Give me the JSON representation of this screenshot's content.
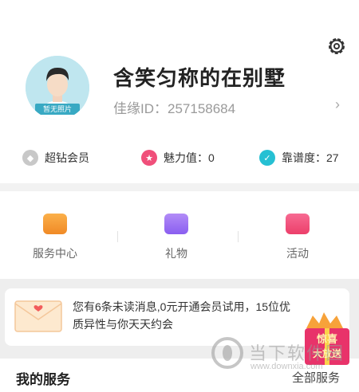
{
  "profile": {
    "avatar_tag": "暂无照片",
    "nickname": "含笑匀称的在别墅",
    "uid": "佳缘ID：257158684"
  },
  "stats": [
    {
      "icon": "diamond-icon",
      "label": "超钻会员"
    },
    {
      "icon": "star-icon",
      "label": "魅力值：0"
    },
    {
      "icon": "shield-icon",
      "label": "靠谱度：27"
    }
  ],
  "menu": [
    {
      "icon": "wallet-icon",
      "label": "服务中心"
    },
    {
      "icon": "gift-icon",
      "label": "礼物"
    },
    {
      "icon": "ticket-icon",
      "label": "活动"
    }
  ],
  "banner": {
    "text": "您有6条未读消息,0元开通会员试用，15位优质异性与你天天约会"
  },
  "promo": {
    "line1": "惊喜",
    "line2": "大放送"
  },
  "watermark": {
    "text": "当下软件园",
    "url": "www.downxia.com"
  },
  "services": {
    "title": "我的服务",
    "all_label": "全部服务"
  },
  "colors": {
    "accent_orange": "#f39a2e",
    "accent_purple": "#9a6cf0",
    "accent_pink": "#f04f7a",
    "accent_teal": "#26c0d3"
  }
}
